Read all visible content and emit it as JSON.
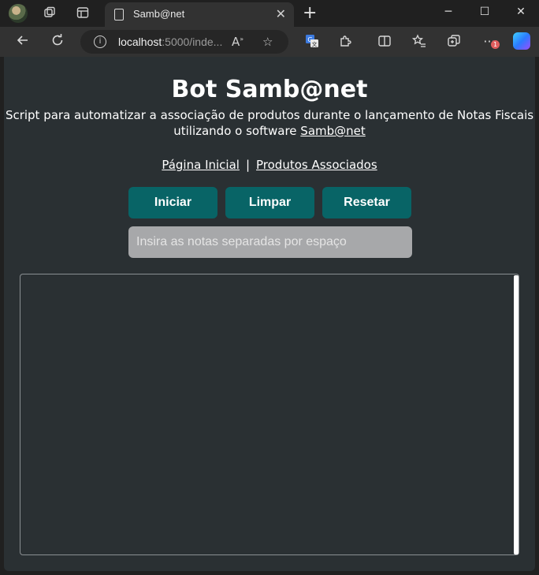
{
  "browser": {
    "tab_title": "Samb@net",
    "url_host": "localhost",
    "url_rest": ":5000/inde...",
    "notification_count": "1",
    "icons": [
      "profile-avatar",
      "workspaces-icon",
      "tab-actions-icon",
      "page-icon",
      "close-icon",
      "new-tab-icon",
      "minimize-icon",
      "maximize-icon",
      "window-close-icon",
      "back-icon",
      "refresh-icon",
      "info-icon",
      "read-aloud-icon",
      "favorite-star-icon",
      "translate-icon",
      "extensions-icon",
      "split-screen-icon",
      "favorites-icon",
      "collections-icon",
      "more-icon",
      "copilot-icon"
    ]
  },
  "page": {
    "title": "Bot Samb@net",
    "subtitle_text": "Script para automatizar a associação de produtos durante o lançamento de Notas Fiscais utilizando o software",
    "subtitle_link": "Samb@net",
    "nav": {
      "home": "Página Inicial",
      "separator": "|",
      "associated": "Produtos Associados"
    },
    "buttons": {
      "start": "Iniciar",
      "clear": "Limpar",
      "reset": "Resetar"
    },
    "notes_input": {
      "value": "",
      "placeholder": "Insira as notas separadas por espaço"
    },
    "log_output": ""
  },
  "colors": {
    "page_bg": "#2a3033",
    "button_bg": "#086466",
    "input_bg": "#a7a8aa",
    "chrome_dark": "#202020",
    "chrome_toolbar": "#323232"
  }
}
